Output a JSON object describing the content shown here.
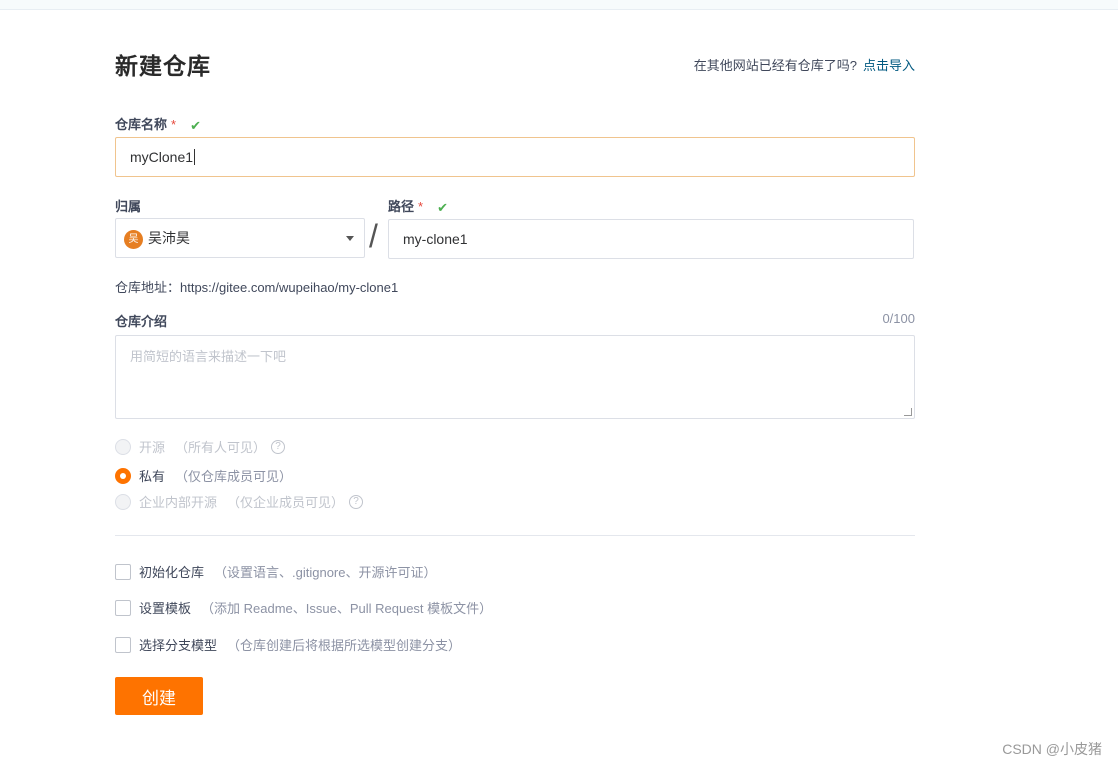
{
  "page": {
    "title": "新建仓库",
    "import_prompt": "在其他网站已经有仓库了吗?",
    "import_link": "点击导入"
  },
  "repo_name": {
    "label": "仓库名称",
    "required_mark": "*",
    "valid_icon": "check-icon",
    "value": "myClone1"
  },
  "owner": {
    "label": "归属",
    "avatar_text": "吴",
    "value": "吴沛昊"
  },
  "separator": "/",
  "path": {
    "label": "路径",
    "required_mark": "*",
    "value": "my-clone1"
  },
  "address": "仓库地址：https://gitee.com/wupeihao/my-clone1",
  "description": {
    "label": "仓库介绍",
    "counter": "0/100",
    "placeholder": "用简短的语言来描述一下吧"
  },
  "visibility": {
    "options": [
      {
        "label": "开源",
        "note": "（所有人可见）",
        "help": true,
        "selected": false,
        "disabled": true
      },
      {
        "label": "私有",
        "note": "（仅仓库成员可见）",
        "help": false,
        "selected": true,
        "disabled": false
      },
      {
        "label": "企业内部开源",
        "note": "（仅企业成员可见）",
        "help": true,
        "selected": false,
        "disabled": true
      }
    ]
  },
  "options": [
    {
      "label": "初始化仓库",
      "note": "（设置语言、.gitignore、开源许可证）",
      "checked": false
    },
    {
      "label": "设置模板",
      "note": "（添加 Readme、Issue、Pull Request 模板文件）",
      "checked": false
    },
    {
      "label": "选择分支模型",
      "note": "（仓库创建后将根据所选模型创建分支）",
      "checked": false
    }
  ],
  "create_button": "创建",
  "watermark": "CSDN @小皮猪",
  "colors": {
    "accent": "#fe7300",
    "link": "#005980",
    "valid": "#4caf50",
    "required": "#e6483c"
  }
}
